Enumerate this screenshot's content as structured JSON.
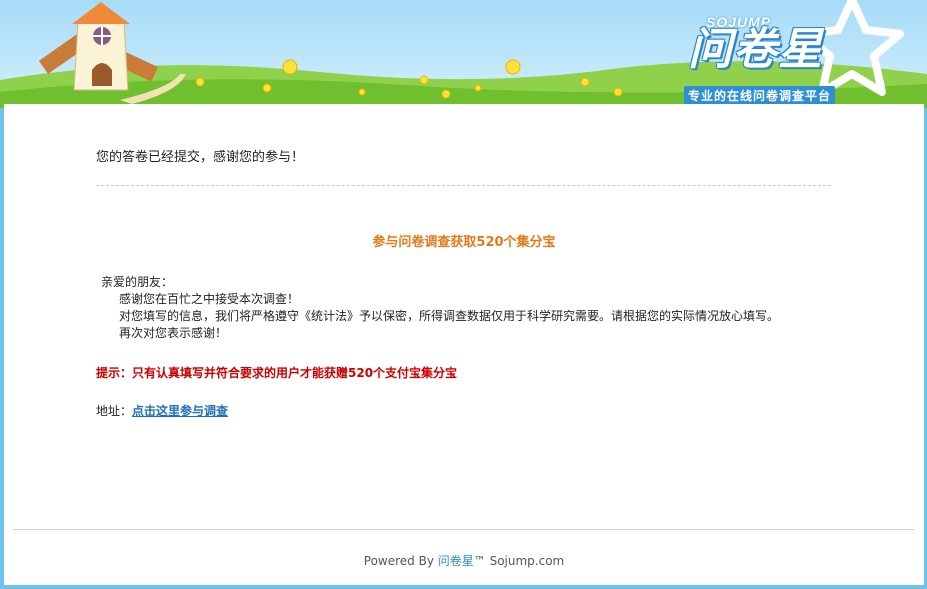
{
  "header": {
    "logo_small": "SOJUMP",
    "logo_big": "问卷星",
    "slogan": "专业的在线问卷调查平台"
  },
  "content": {
    "thanks_message": "您的答卷已经提交，感谢您的参与！",
    "promo_title": "参与问卷调查获取520个集分宝",
    "greeting": "亲爱的朋友：",
    "lines": [
      "感谢您在百忙之中接受本次调查！",
      "对您填写的信息，我们将严格遵守《统计法》予以保密，所得调查数据仅用于科学研究需要。请根据您的实际情况放心填写。",
      "再次对您表示感谢！"
    ],
    "tip": "提示：只有认真填写并符合要求的用户才能获赠520个支付宝集分宝",
    "address_label": "地址：",
    "address_link": "点击这里参与调查"
  },
  "footer": {
    "prefix": "Powered By ",
    "brand": "问卷星",
    "suffix": "™ Sojump.com"
  },
  "colors": {
    "frame": "#6ec4ee",
    "promo_title": "#e07b1c",
    "tip": "#cc0000",
    "link": "#1f6fb3"
  }
}
